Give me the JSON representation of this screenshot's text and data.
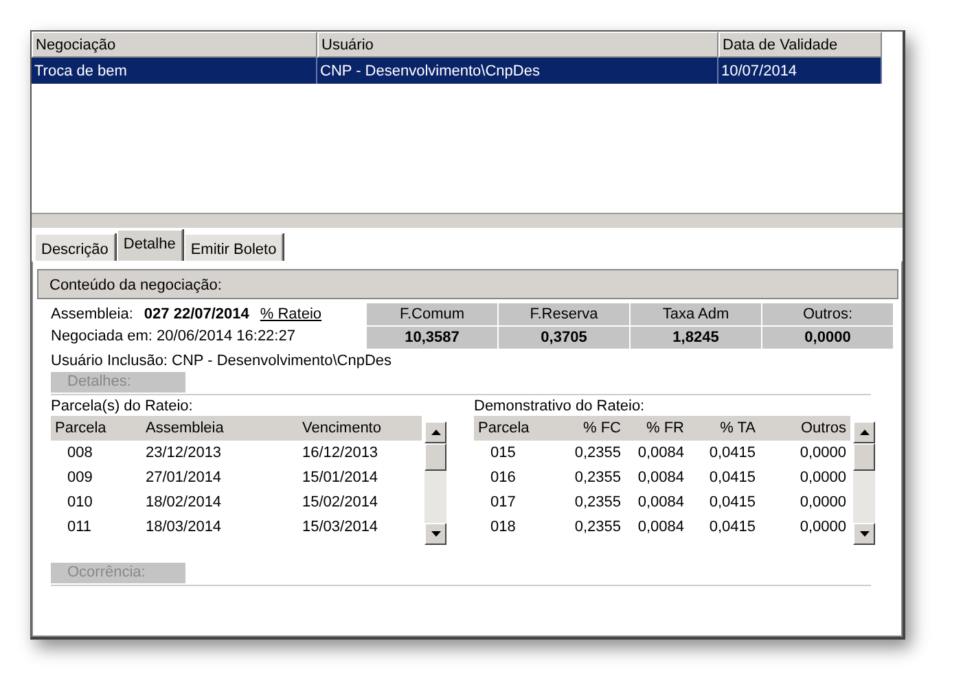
{
  "grid": {
    "columns": [
      "Negociação",
      "Usuário",
      "Data de Validade"
    ],
    "rows": [
      {
        "cells": [
          "Troca de bem",
          "CNP - Desenvolvimento\\CnpDes",
          "10/07/2014"
        ],
        "selected": true
      }
    ]
  },
  "tabs": [
    {
      "label": "Descrição",
      "selected": false
    },
    {
      "label": "Detalhe",
      "selected": true
    },
    {
      "label": "Emitir Boleto",
      "selected": false
    }
  ],
  "group": {
    "title": "Conteúdo da negociação:"
  },
  "assembleia": {
    "label": "Assembleia:",
    "value": "027 22/07/2014",
    "link": "% Rateio"
  },
  "negociada": "Negociada em: 20/06/2014 16:22:27",
  "usuario_inclusao": "Usuário Inclusão:  CNP - Desenvolvimento\\CnpDes",
  "totals": [
    {
      "label": "F.Comum",
      "value": "10,3587"
    },
    {
      "label": "F.Reserva",
      "value": "0,3705"
    },
    {
      "label": "Taxa Adm",
      "value": "1,8245"
    },
    {
      "label": "Outros:",
      "value": "0,0000"
    }
  ],
  "detalhes": {
    "label": "Detalhes:",
    "disabled": true
  },
  "parcelas": {
    "title": "Parcela(s) do Rateio:",
    "columns": [
      "Parcela",
      "Assembleia",
      "Vencimento"
    ],
    "rows": [
      [
        "008",
        "23/12/2013",
        "16/12/2013"
      ],
      [
        "009",
        "27/01/2014",
        "15/01/2014"
      ],
      [
        "010",
        "18/02/2014",
        "15/02/2014"
      ],
      [
        "011",
        "18/03/2014",
        "15/03/2014"
      ]
    ]
  },
  "demonstrativo": {
    "title": "Demonstrativo do Rateio:",
    "columns": [
      "Parcela",
      "% FC",
      "% FR",
      "% TA",
      "Outros"
    ],
    "rows": [
      [
        "015",
        "0,2355",
        "0,0084",
        "0,0415",
        "0,0000"
      ],
      [
        "016",
        "0,2355",
        "0,0084",
        "0,0415",
        "0,0000"
      ],
      [
        "017",
        "0,2355",
        "0,0084",
        "0,0415",
        "0,0000"
      ],
      [
        "018",
        "0,2355",
        "0,0084",
        "0,0415",
        "0,0000"
      ]
    ]
  },
  "ocorrencia": {
    "label": "Ocorrência:",
    "disabled": true
  }
}
